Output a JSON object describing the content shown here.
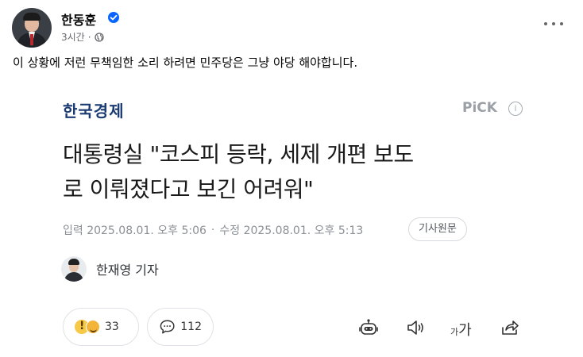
{
  "post": {
    "author": "한동훈",
    "time": "3시간",
    "dot": "·",
    "text": "이 상황에 저런 무책임한 소리 하려면 민주당은 그냥 야당 해야합니다."
  },
  "article": {
    "brand": "한국경제",
    "pick": "PiCK",
    "info": "i",
    "headline_line1": "대통령실 \"코스피 등락, 세제 개편 보도",
    "headline_line2": "로 이뤄졌다고 보긴 어려워\"",
    "published": "입력 2025.08.01. 오후 5:06",
    "modified": "수정 2025.08.01. 오후 5:13",
    "date_sep": "·",
    "origin_button": "기사원문",
    "reporter": "한재영 기자"
  },
  "toolbar": {
    "reactions_count": "33",
    "comments_count": "112",
    "text_size_small": "가",
    "text_size_big": "가"
  },
  "icons": {
    "verified": "verified-badge-icon",
    "globe": "globe-icon",
    "more": "more-options-icon",
    "comment": "comment-bubble-icon",
    "bot": "robot-summary-icon",
    "audio": "speaker-icon",
    "share": "share-icon"
  },
  "colors": {
    "verified": "#0866ff",
    "brand": "#1b3b73",
    "meta": "#65676b"
  }
}
